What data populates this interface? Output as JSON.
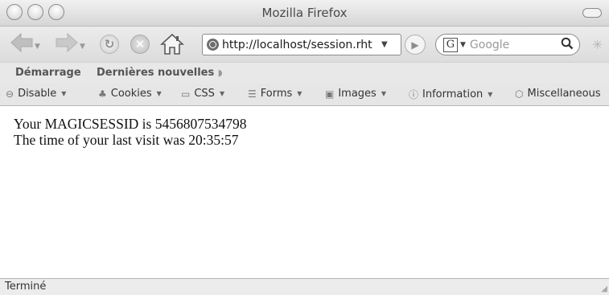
{
  "window": {
    "title": "Mozilla Firefox"
  },
  "navigation": {
    "back_icon": "back-arrow-icon",
    "forward_icon": "forward-arrow-icon",
    "url": "http://localhost/session.rht",
    "search_placeholder": "Google"
  },
  "bookmarks": [
    "Démarrage",
    "Dernières nouvelles"
  ],
  "devtoolbar": {
    "items": [
      "Disable",
      "Cookies",
      "CSS",
      "Forms",
      "Images",
      "Information",
      "Miscellaneous"
    ]
  },
  "content": {
    "line1": "Your MAGICSESSID is 5456807534798",
    "line2": "The time of your last visit was 20:35:57"
  },
  "status": {
    "text": "Terminé"
  }
}
